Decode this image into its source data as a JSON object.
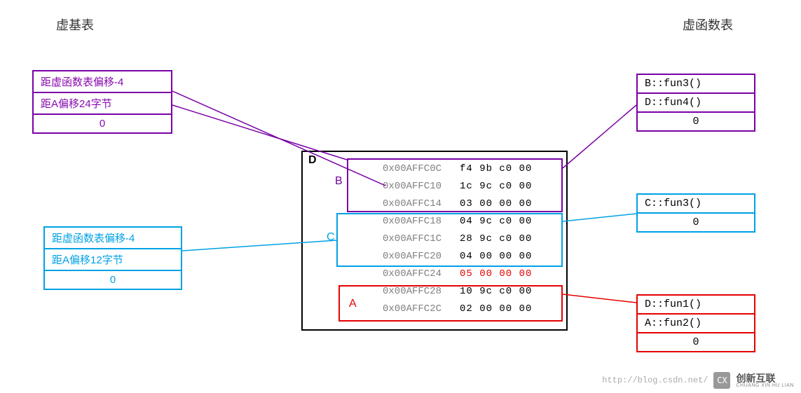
{
  "headings": {
    "left": "虚基表",
    "right": "虚函数表"
  },
  "vbtable_b": {
    "row0": "距虚函数表偏移-4",
    "row1": "距A偏移24字节",
    "row2": "0"
  },
  "vbtable_c": {
    "row0": "距虚函数表偏移-4",
    "row1": "距A偏移12字节",
    "row2": "0"
  },
  "vftable_b": {
    "row0": "B::fun3()",
    "row1": "D::fun4()",
    "row2": "0"
  },
  "vftable_c": {
    "row0": "C::fun3()",
    "row1": "0"
  },
  "vftable_a": {
    "row0": "D::fun1()",
    "row1": "A::fun2()",
    "row2": "0"
  },
  "memory": {
    "outer_label": "D",
    "sub_b_label": "B",
    "sub_c_label": "C",
    "sub_a_label": "A",
    "rows": [
      {
        "addr": "0x00AFFC0C",
        "bytes": "f4 9b c0 00",
        "red": false
      },
      {
        "addr": "0x00AFFC10",
        "bytes": "1c 9c c0 00",
        "red": false
      },
      {
        "addr": "0x00AFFC14",
        "bytes": "03 00 00 00",
        "red": false
      },
      {
        "addr": "0x00AFFC18",
        "bytes": "04 9c c0 00",
        "red": false
      },
      {
        "addr": "0x00AFFC1C",
        "bytes": "28 9c c0 00",
        "red": false
      },
      {
        "addr": "0x00AFFC20",
        "bytes": "04 00 00 00",
        "red": false
      },
      {
        "addr": "0x00AFFC24",
        "bytes": "05 00 00 00",
        "red": true
      },
      {
        "addr": "0x00AFFC28",
        "bytes": "10 9c c0 00",
        "red": false
      },
      {
        "addr": "0x00AFFC2C",
        "bytes": "02 00 00 00",
        "red": false
      }
    ]
  },
  "footer": {
    "url": "http://blog.csdn.net/",
    "brand": "创新互联",
    "brand_sub": "CHUANG XIN HU LIAN",
    "logo": "CX"
  }
}
